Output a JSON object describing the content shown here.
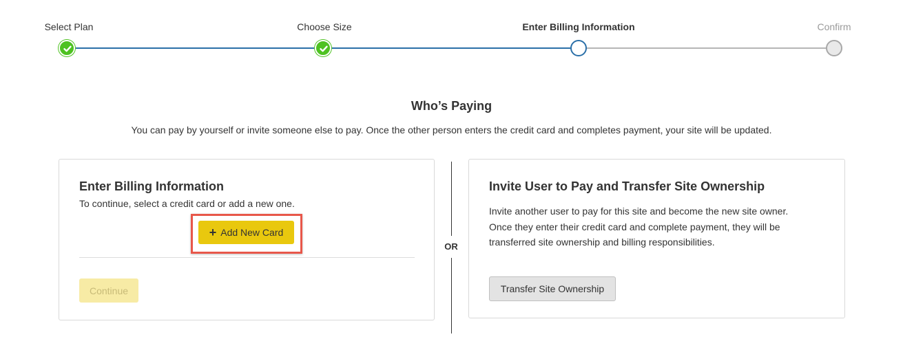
{
  "stepper": {
    "steps": [
      {
        "label": "Select Plan",
        "state": "done"
      },
      {
        "label": "Choose Size",
        "state": "done"
      },
      {
        "label": "Enter Billing Information",
        "state": "current"
      },
      {
        "label": "Confirm",
        "state": "pending"
      }
    ]
  },
  "section": {
    "title": "Who’s Paying",
    "description": "You can pay by yourself or invite someone else to pay. Once the other person enters the credit card and completes payment, your site will be updated."
  },
  "billing": {
    "title": "Enter Billing Information",
    "instructions": "To continue, select a credit card or add a new one.",
    "add_card_label": "Add New Card",
    "add_card_icon": "plus-icon",
    "continue_label": "Continue"
  },
  "separator": {
    "label": "OR"
  },
  "invite": {
    "title": "Invite User to Pay and Transfer Site Ownership",
    "description": "Invite another user to pay for this site and become the new site owner. Once they enter their credit card and complete payment, they will be transferred site ownership and billing responsibilities.",
    "transfer_label": "Transfer Site Ownership"
  },
  "colors": {
    "accent": "#2a6fa8",
    "success": "#4ec221",
    "primary_button": "#e9c80e",
    "highlight": "#e8574a"
  }
}
